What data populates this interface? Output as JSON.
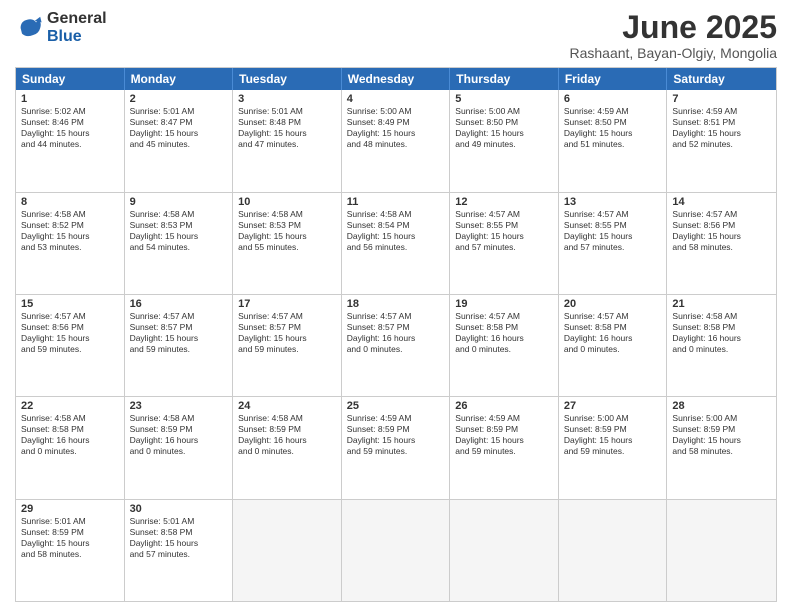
{
  "logo": {
    "general": "General",
    "blue": "Blue"
  },
  "title": "June 2025",
  "subtitle": "Rashaant, Bayan-Olgiy, Mongolia",
  "header_days": [
    "Sunday",
    "Monday",
    "Tuesday",
    "Wednesday",
    "Thursday",
    "Friday",
    "Saturday"
  ],
  "rows": [
    [
      {
        "day": "1",
        "lines": [
          "Sunrise: 5:02 AM",
          "Sunset: 8:46 PM",
          "Daylight: 15 hours",
          "and 44 minutes."
        ]
      },
      {
        "day": "2",
        "lines": [
          "Sunrise: 5:01 AM",
          "Sunset: 8:47 PM",
          "Daylight: 15 hours",
          "and 45 minutes."
        ]
      },
      {
        "day": "3",
        "lines": [
          "Sunrise: 5:01 AM",
          "Sunset: 8:48 PM",
          "Daylight: 15 hours",
          "and 47 minutes."
        ]
      },
      {
        "day": "4",
        "lines": [
          "Sunrise: 5:00 AM",
          "Sunset: 8:49 PM",
          "Daylight: 15 hours",
          "and 48 minutes."
        ]
      },
      {
        "day": "5",
        "lines": [
          "Sunrise: 5:00 AM",
          "Sunset: 8:50 PM",
          "Daylight: 15 hours",
          "and 49 minutes."
        ]
      },
      {
        "day": "6",
        "lines": [
          "Sunrise: 4:59 AM",
          "Sunset: 8:50 PM",
          "Daylight: 15 hours",
          "and 51 minutes."
        ]
      },
      {
        "day": "7",
        "lines": [
          "Sunrise: 4:59 AM",
          "Sunset: 8:51 PM",
          "Daylight: 15 hours",
          "and 52 minutes."
        ]
      }
    ],
    [
      {
        "day": "8",
        "lines": [
          "Sunrise: 4:58 AM",
          "Sunset: 8:52 PM",
          "Daylight: 15 hours",
          "and 53 minutes."
        ]
      },
      {
        "day": "9",
        "lines": [
          "Sunrise: 4:58 AM",
          "Sunset: 8:53 PM",
          "Daylight: 15 hours",
          "and 54 minutes."
        ]
      },
      {
        "day": "10",
        "lines": [
          "Sunrise: 4:58 AM",
          "Sunset: 8:53 PM",
          "Daylight: 15 hours",
          "and 55 minutes."
        ]
      },
      {
        "day": "11",
        "lines": [
          "Sunrise: 4:58 AM",
          "Sunset: 8:54 PM",
          "Daylight: 15 hours",
          "and 56 minutes."
        ]
      },
      {
        "day": "12",
        "lines": [
          "Sunrise: 4:57 AM",
          "Sunset: 8:55 PM",
          "Daylight: 15 hours",
          "and 57 minutes."
        ]
      },
      {
        "day": "13",
        "lines": [
          "Sunrise: 4:57 AM",
          "Sunset: 8:55 PM",
          "Daylight: 15 hours",
          "and 57 minutes."
        ]
      },
      {
        "day": "14",
        "lines": [
          "Sunrise: 4:57 AM",
          "Sunset: 8:56 PM",
          "Daylight: 15 hours",
          "and 58 minutes."
        ]
      }
    ],
    [
      {
        "day": "15",
        "lines": [
          "Sunrise: 4:57 AM",
          "Sunset: 8:56 PM",
          "Daylight: 15 hours",
          "and 59 minutes."
        ]
      },
      {
        "day": "16",
        "lines": [
          "Sunrise: 4:57 AM",
          "Sunset: 8:57 PM",
          "Daylight: 15 hours",
          "and 59 minutes."
        ]
      },
      {
        "day": "17",
        "lines": [
          "Sunrise: 4:57 AM",
          "Sunset: 8:57 PM",
          "Daylight: 15 hours",
          "and 59 minutes."
        ]
      },
      {
        "day": "18",
        "lines": [
          "Sunrise: 4:57 AM",
          "Sunset: 8:57 PM",
          "Daylight: 16 hours",
          "and 0 minutes."
        ]
      },
      {
        "day": "19",
        "lines": [
          "Sunrise: 4:57 AM",
          "Sunset: 8:58 PM",
          "Daylight: 16 hours",
          "and 0 minutes."
        ]
      },
      {
        "day": "20",
        "lines": [
          "Sunrise: 4:57 AM",
          "Sunset: 8:58 PM",
          "Daylight: 16 hours",
          "and 0 minutes."
        ]
      },
      {
        "day": "21",
        "lines": [
          "Sunrise: 4:58 AM",
          "Sunset: 8:58 PM",
          "Daylight: 16 hours",
          "and 0 minutes."
        ]
      }
    ],
    [
      {
        "day": "22",
        "lines": [
          "Sunrise: 4:58 AM",
          "Sunset: 8:58 PM",
          "Daylight: 16 hours",
          "and 0 minutes."
        ]
      },
      {
        "day": "23",
        "lines": [
          "Sunrise: 4:58 AM",
          "Sunset: 8:59 PM",
          "Daylight: 16 hours",
          "and 0 minutes."
        ]
      },
      {
        "day": "24",
        "lines": [
          "Sunrise: 4:58 AM",
          "Sunset: 8:59 PM",
          "Daylight: 16 hours",
          "and 0 minutes."
        ]
      },
      {
        "day": "25",
        "lines": [
          "Sunrise: 4:59 AM",
          "Sunset: 8:59 PM",
          "Daylight: 15 hours",
          "and 59 minutes."
        ]
      },
      {
        "day": "26",
        "lines": [
          "Sunrise: 4:59 AM",
          "Sunset: 8:59 PM",
          "Daylight: 15 hours",
          "and 59 minutes."
        ]
      },
      {
        "day": "27",
        "lines": [
          "Sunrise: 5:00 AM",
          "Sunset: 8:59 PM",
          "Daylight: 15 hours",
          "and 59 minutes."
        ]
      },
      {
        "day": "28",
        "lines": [
          "Sunrise: 5:00 AM",
          "Sunset: 8:59 PM",
          "Daylight: 15 hours",
          "and 58 minutes."
        ]
      }
    ],
    [
      {
        "day": "29",
        "lines": [
          "Sunrise: 5:01 AM",
          "Sunset: 8:59 PM",
          "Daylight: 15 hours",
          "and 58 minutes."
        ]
      },
      {
        "day": "30",
        "lines": [
          "Sunrise: 5:01 AM",
          "Sunset: 8:58 PM",
          "Daylight: 15 hours",
          "and 57 minutes."
        ]
      },
      {
        "day": "",
        "lines": []
      },
      {
        "day": "",
        "lines": []
      },
      {
        "day": "",
        "lines": []
      },
      {
        "day": "",
        "lines": []
      },
      {
        "day": "",
        "lines": []
      }
    ]
  ]
}
